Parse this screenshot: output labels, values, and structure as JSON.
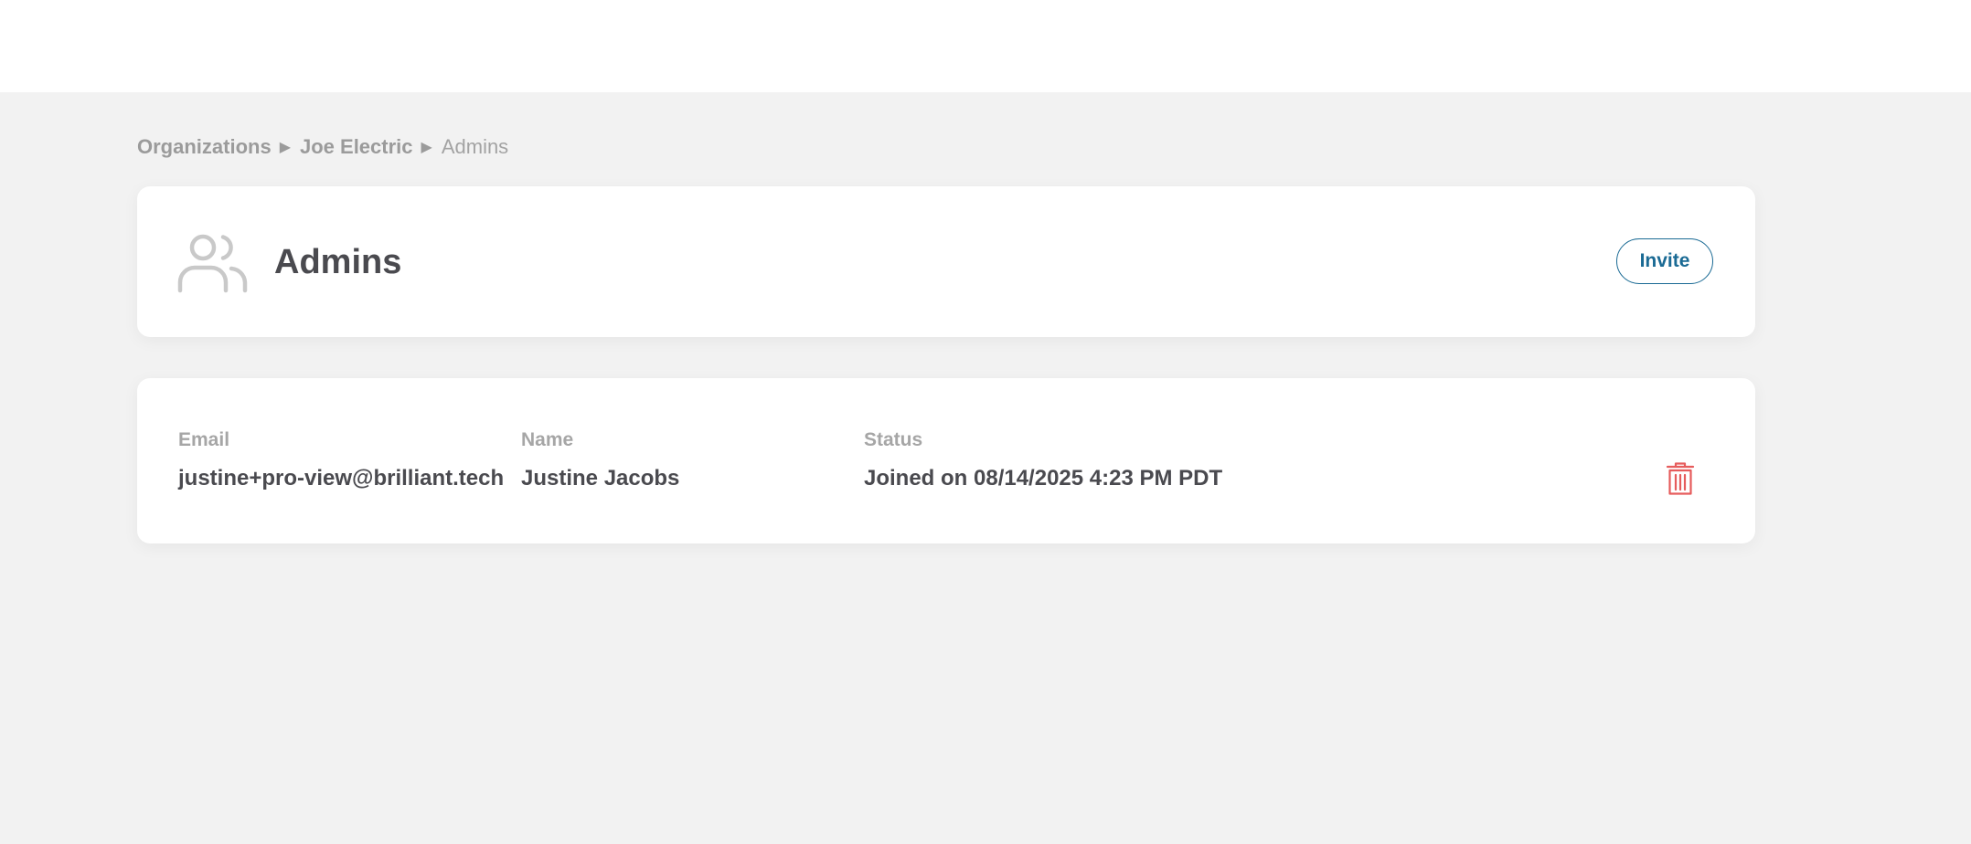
{
  "breadcrumb": {
    "items": [
      "Organizations",
      "Joe Electric"
    ],
    "separator": "▶",
    "current": "Admins"
  },
  "header": {
    "title": "Admins",
    "icon": "users-icon",
    "invite_label": "Invite"
  },
  "table": {
    "columns": [
      "Email",
      "Name",
      "Status"
    ],
    "rows": [
      {
        "email": "justine+pro-view@brilliant.tech",
        "name": "Justine Jacobs",
        "status": "Joined on 08/14/2025 4:23 PM PDT",
        "action_icon": "trash-icon"
      }
    ]
  },
  "colors": {
    "accent": "#1a6a94",
    "danger": "#e65c5c",
    "background": "#f2f2f2",
    "muted_text": "#9b9b9b",
    "primary_text": "#4a4a4f"
  }
}
